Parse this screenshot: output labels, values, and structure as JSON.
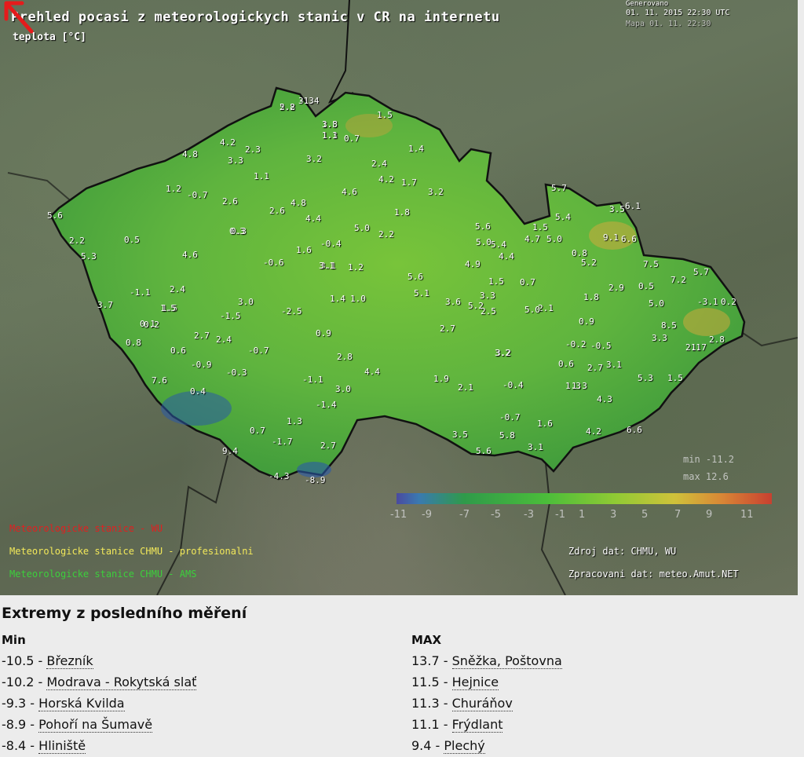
{
  "map": {
    "title": "Prehled pocasi z meteorologickych stanic v CR na internetu",
    "subtitle": "teplota  [°C]",
    "generated_label": "Generovano",
    "generated_date": "01. 11. 2015 22:30 UTC",
    "map_date": "Mapa 01. 11. 22:30",
    "min_text": "min -11.2",
    "max_text": "max 12.6",
    "scale_labels": [
      "-11",
      "-9",
      "-7",
      "-5",
      "-3",
      "-1",
      "1",
      "3",
      "5",
      "7",
      "9",
      "11"
    ],
    "legend": [
      {
        "text": "Meteorologicke stanice - WU",
        "color": "#e02020"
      },
      {
        "text": "Meteorologicke stanice CHMU - profesionalni",
        "color": "#f2e85a"
      },
      {
        "text": "Meteorologicke stanice CHMU - AMS",
        "color": "#3ccf3c"
      }
    ],
    "source_text": "Zdroj dat: CHMU, WU",
    "processed_text": "Zpracovani dat:  meteo.Amut.NET",
    "station_labels": [
      "5.8",
      "3.3",
      "1.5",
      "1.3",
      "0.7",
      "1.5",
      "1.4",
      "3.2",
      "2.4",
      "4.2",
      "1.7",
      "3.2",
      "4.6",
      "4.8",
      "2.6",
      "4.4",
      "5.0",
      "2.2",
      "1.8",
      "5.6",
      "5.0",
      "4.9",
      "1.5",
      "0.7",
      "3.1",
      "1.2",
      "-0.6",
      "-0.4",
      "1.6",
      "3.1",
      "1.4",
      "1.0",
      "5.6",
      "5.1",
      "3.6",
      "-2.5",
      "0.9",
      "2.8",
      "4.4",
      "1.9",
      "2.1",
      "-0.4",
      "1.3",
      "3.2",
      "2.7",
      "-1.1",
      "3.0",
      "-1.4",
      "1.3",
      "2.7",
      "-1.7",
      "-4.3",
      "-8.9",
      "5.2",
      "9.4",
      "0.7",
      "-0.9",
      "-0.3",
      "0.4",
      "2.4",
      "2.7",
      "-0.7",
      "3.0",
      "-1.5",
      "1.5",
      "-1.1",
      "2.4",
      "0.1",
      "0.5",
      "4.6",
      "0.3",
      "2.6",
      "-0.7",
      "1.2",
      "0.3",
      "1.1",
      "3.3",
      "2.3",
      "4.2",
      "4.8",
      "7.6",
      "0.6",
      "1.5",
      "0.8",
      "0.2",
      "3.7",
      "5.3",
      "2.2",
      "5.6",
      "3.5",
      "6.1",
      "5.7",
      "6.6",
      "9.1",
      "7.5",
      "7.2",
      "5.7",
      "5.0",
      "8.5",
      "3.3",
      "2.1",
      "2.8",
      "0.9",
      "-0.2",
      "-0.5",
      "3.1",
      "5.3",
      "1.5",
      "4.3",
      "6.6",
      "4.2",
      "-0.7",
      "3.5",
      "5.6",
      "3.1",
      "1.6",
      "5.8",
      "0.6",
      "2.7",
      "1.3",
      "3.2",
      "2.1",
      "2.5",
      "3.3",
      "5.0",
      "-3.1",
      "0.2",
      "0.5",
      "2.9",
      "5.2",
      "0.8",
      "5.4",
      "4.4",
      "1.8",
      "5.4",
      "4.7",
      "5.0",
      "1.5",
      "1.7",
      "2.2",
      "-1.4",
      "3.8",
      "1.1"
    ],
    "colors": {
      "land": "#6cb83c",
      "border": "#111111",
      "arrow": "#e51b1b"
    }
  },
  "extremes": {
    "title": "Extremy z posledního měření",
    "min_header": "Min",
    "max_header": "MAX",
    "min_rows": [
      {
        "value": "-10.5",
        "name": "Březník"
      },
      {
        "value": "-10.2",
        "name": "Modrava - Rokytská slať"
      },
      {
        "value": "-9.3",
        "name": "Horská Kvilda"
      },
      {
        "value": "-8.9",
        "name": "Pohoří na Šumavě"
      },
      {
        "value": "-8.4",
        "name": "Hliniště"
      }
    ],
    "max_rows": [
      {
        "value": "13.7",
        "name": "Sněžka, Poštovna"
      },
      {
        "value": "11.5",
        "name": "Hejnice"
      },
      {
        "value": "11.3",
        "name": "Churáňov"
      },
      {
        "value": "11.1",
        "name": "Frýdlant"
      },
      {
        "value": "9.4",
        "name": "Plechý"
      }
    ],
    "separator": " - "
  }
}
